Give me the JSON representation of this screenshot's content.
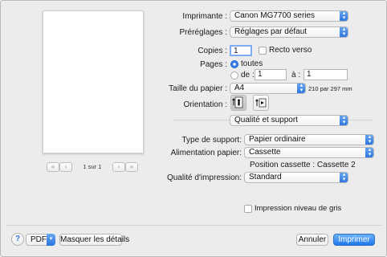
{
  "preview": {
    "page_label": "1 sur 1",
    "first_icon": "«",
    "prev_icon": "‹",
    "next_icon": "›",
    "last_icon": "»"
  },
  "printer": {
    "label": "Imprimante :",
    "value": "Canon MG7700 series"
  },
  "presets": {
    "label": "Préréglages :",
    "value": "Réglages par défaut"
  },
  "copies": {
    "label": "Copies :",
    "value": "1",
    "duplex_label": "Recto verso",
    "duplex_checked": false
  },
  "pages": {
    "label": "Pages :",
    "all_label": "toutes",
    "from_label": "de :",
    "from_value": "1",
    "to_label": "à :",
    "to_value": "1",
    "selected": "all"
  },
  "paper_size": {
    "label": "Taille du papier :",
    "value": "A4",
    "note": "210 par 297 mm"
  },
  "orientation": {
    "label": "Orientation :",
    "selected": "portrait"
  },
  "section": {
    "value": "Qualité et support"
  },
  "media_type": {
    "label": "Type de support:",
    "value": "Papier ordinaire"
  },
  "paper_source": {
    "label": "Alimentation papier:",
    "value": "Cassette",
    "position_note": "Position cassette : Cassette 2"
  },
  "quality": {
    "label": "Qualité d'impression:",
    "value": "Standard"
  },
  "grayscale": {
    "label": "Impression niveau de gris",
    "checked": false
  },
  "footer": {
    "help_glyph": "?",
    "pdf_label": "PDF",
    "hide_details_label": "Masquer les détails",
    "cancel_label": "Annuler",
    "print_label": "Imprimer"
  },
  "colors": {
    "accent": "#2a73de"
  }
}
